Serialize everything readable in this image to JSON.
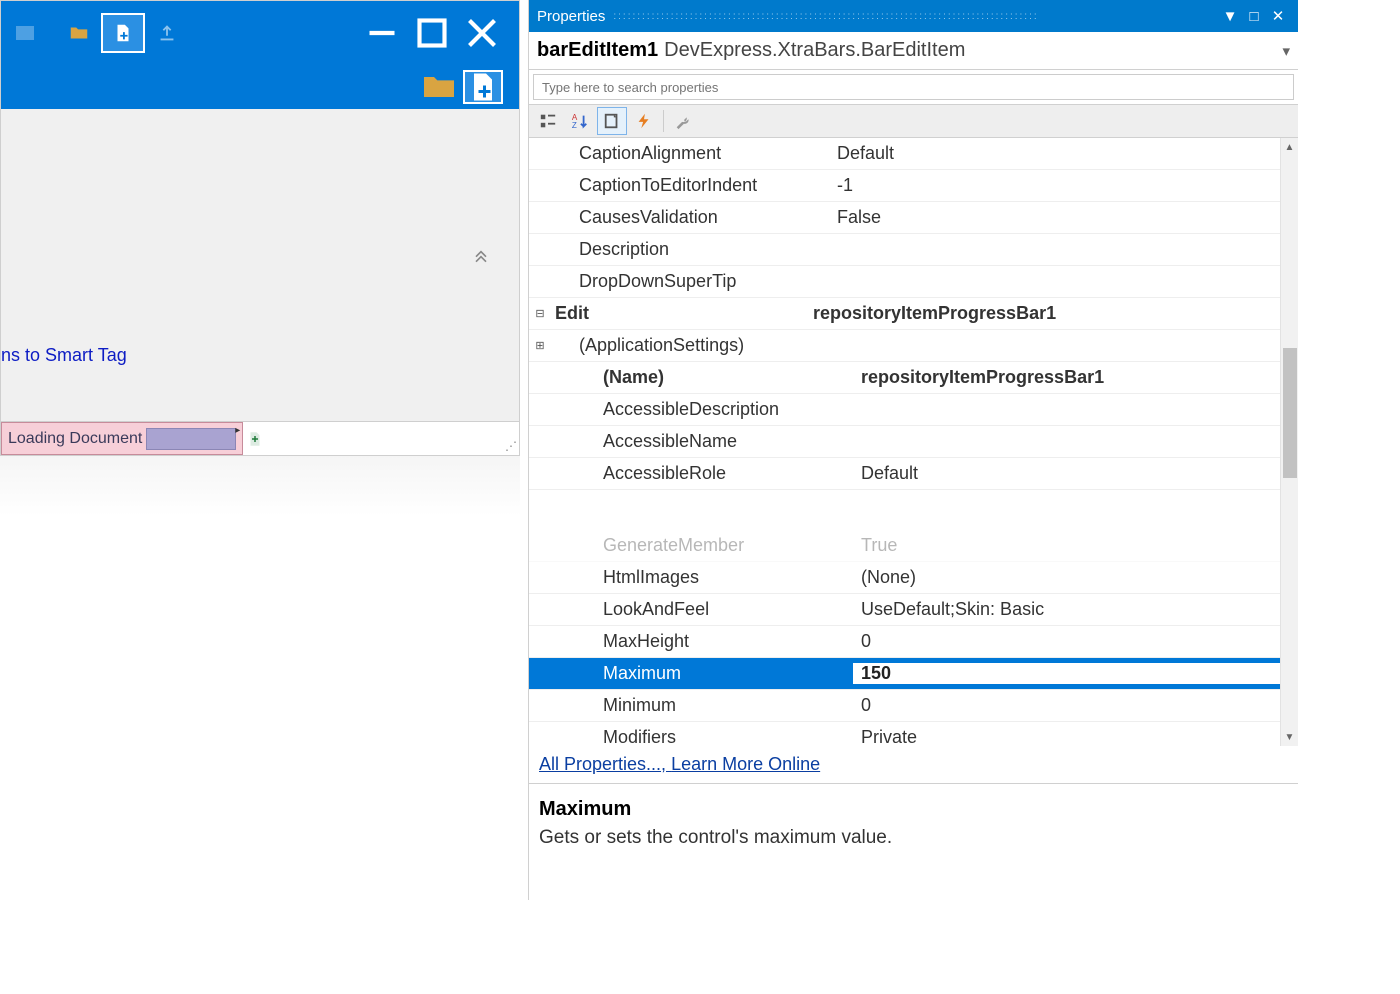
{
  "designer": {
    "smart_tag_text": "ns to Smart Tag",
    "status": {
      "loading_label": "Loading Document"
    }
  },
  "properties": {
    "panel_title": "Properties",
    "selector": {
      "name": "barEditItem1",
      "type": "DevExpress.XtraBars.BarEditItem"
    },
    "search_placeholder": "Type here to search properties",
    "rows_top": [
      {
        "indent": 1,
        "name": "CaptionAlignment",
        "value": "Default"
      },
      {
        "indent": 1,
        "name": "CaptionToEditorIndent",
        "value": "-1"
      },
      {
        "indent": 1,
        "name": "CausesValidation",
        "value": "False"
      },
      {
        "indent": 1,
        "name": "Description",
        "value": ""
      },
      {
        "indent": 1,
        "name": "DropDownSuperTip",
        "value": ""
      },
      {
        "gutter": "⊟",
        "indent": 0,
        "name": "Edit",
        "value": "repositoryItemProgressBar1",
        "bold": true
      },
      {
        "gutter": "⊞",
        "indent": 1,
        "name": "(ApplicationSettings)",
        "value": ""
      },
      {
        "indent": 2,
        "name": "(Name)",
        "value": "repositoryItemProgressBar1",
        "bold": true
      },
      {
        "indent": 2,
        "name": "AccessibleDescription",
        "value": ""
      },
      {
        "indent": 2,
        "name": "AccessibleName",
        "value": ""
      },
      {
        "indent": 2,
        "name": "AccessibleRole",
        "value": "Default"
      }
    ],
    "rows_bottom": [
      {
        "indent": 2,
        "name": "GenerateMember",
        "value": "True",
        "fade": true
      },
      {
        "indent": 2,
        "name": "HtmlImages",
        "value": "(None)"
      },
      {
        "indent": 2,
        "name": "LookAndFeel",
        "value": "UseDefault;Skin: Basic"
      },
      {
        "indent": 2,
        "name": "MaxHeight",
        "value": "0"
      },
      {
        "indent": 2,
        "name": "Maximum",
        "value": "150",
        "selected": true
      },
      {
        "indent": 2,
        "name": "Minimum",
        "value": "0"
      },
      {
        "indent": 2,
        "name": "Modifiers",
        "value": "Private"
      }
    ],
    "links": {
      "all": "All Properties...",
      "sep": ", ",
      "learn": "Learn More Online"
    },
    "description": {
      "title": "Maximum",
      "body": "Gets or sets the control's maximum value."
    }
  }
}
